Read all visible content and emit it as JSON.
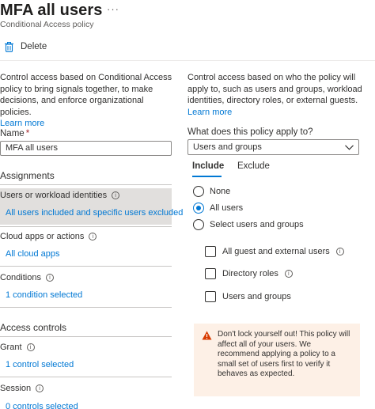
{
  "header": {
    "title": "MFA all users",
    "more_label": "···",
    "subtitle": "Conditional Access policy"
  },
  "toolbar": {
    "delete_label": "Delete"
  },
  "left": {
    "description": "Control access based on Conditional Access policy to bring signals together, to make decisions, and enforce organizational policies.",
    "learn_more": "Learn more",
    "name_label": "Name",
    "name_required": "*",
    "name_value": "MFA all users",
    "assignments_heading": "Assignments",
    "users": {
      "title": "Users or workload identities",
      "summary": "All users included and specific users excluded"
    },
    "cloud_apps": {
      "title": "Cloud apps or actions",
      "summary": "All cloud apps"
    },
    "conditions": {
      "title": "Conditions",
      "summary": "1 condition selected"
    },
    "access_controls_heading": "Access controls",
    "grant": {
      "title": "Grant",
      "summary": "1 control selected"
    },
    "session": {
      "title": "Session",
      "summary": "0 controls selected"
    }
  },
  "right": {
    "description": "Control access based on who the policy will apply to, such as users and groups, workload identities, directory roles, or external guests.",
    "learn_more": "Learn more",
    "apply_label": "What does this policy apply to?",
    "apply_value": "Users and groups",
    "tabs": {
      "include": "Include",
      "exclude": "Exclude"
    },
    "radios": {
      "none": "None",
      "all_users": "All users",
      "select": "Select users and groups",
      "selected": "all_users"
    },
    "checkboxes": {
      "guest": "All guest and external users",
      "roles": "Directory roles",
      "users_groups": "Users and groups"
    },
    "warning": "Don't lock yourself out! This policy will affect all of your users. We recommend applying a policy to a small set of users first to verify it behaves as expected."
  },
  "colors": {
    "accent": "#0078d4",
    "warning_bg": "#fdf0e6",
    "warning_icon": "#d83b01",
    "selected_bg": "#e1dfdd"
  }
}
